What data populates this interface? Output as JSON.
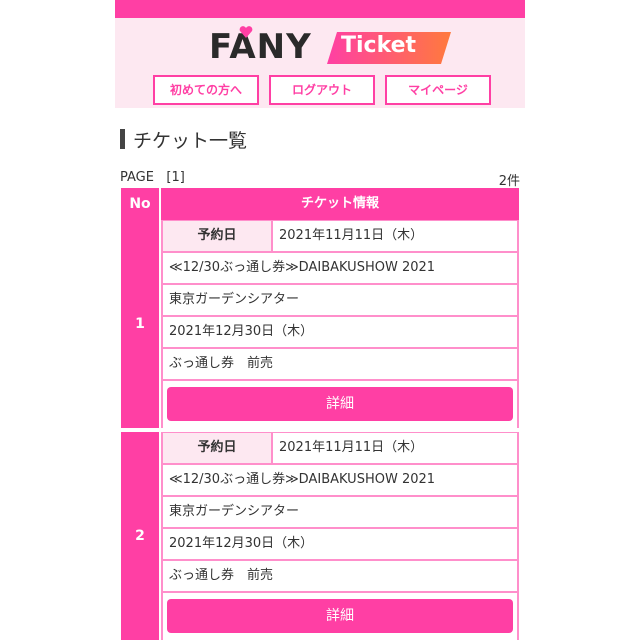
{
  "logo": {
    "brand": "FANY",
    "product": "Ticket"
  },
  "nav": {
    "first_time": "初めての方へ",
    "logout": "ログアウト",
    "mypage": "マイページ"
  },
  "page_title": "チケット一覧",
  "pagination": {
    "page_label": "PAGE",
    "page_number": "[1]",
    "count": "2件"
  },
  "table": {
    "col_no": "No",
    "col_info": "チケット情報"
  },
  "tickets": [
    {
      "no": "1",
      "reservation_label": "予約日",
      "reservation_date": "2021年11月11日（木）",
      "event": "≪12/30ぶっ通し券≫DAIBAKUSHOW 2021",
      "venue": "東京ガーデンシアター",
      "date": "2021年12月30日（木）",
      "ticket_type": "ぶっ通し券　前売",
      "detail_label": "詳細"
    },
    {
      "no": "2",
      "reservation_label": "予約日",
      "reservation_date": "2021年11月11日（木）",
      "event": "≪12/30ぶっ通し券≫DAIBAKUSHOW 2021",
      "venue": "東京ガーデンシアター",
      "date": "2021年12月30日（木）",
      "ticket_type": "ぶっ通し券　前売",
      "detail_label": "詳細"
    }
  ],
  "colors": {
    "accent": "#ff3fa4",
    "accent_light": "#fde8f1",
    "border": "#ff8fcb"
  }
}
